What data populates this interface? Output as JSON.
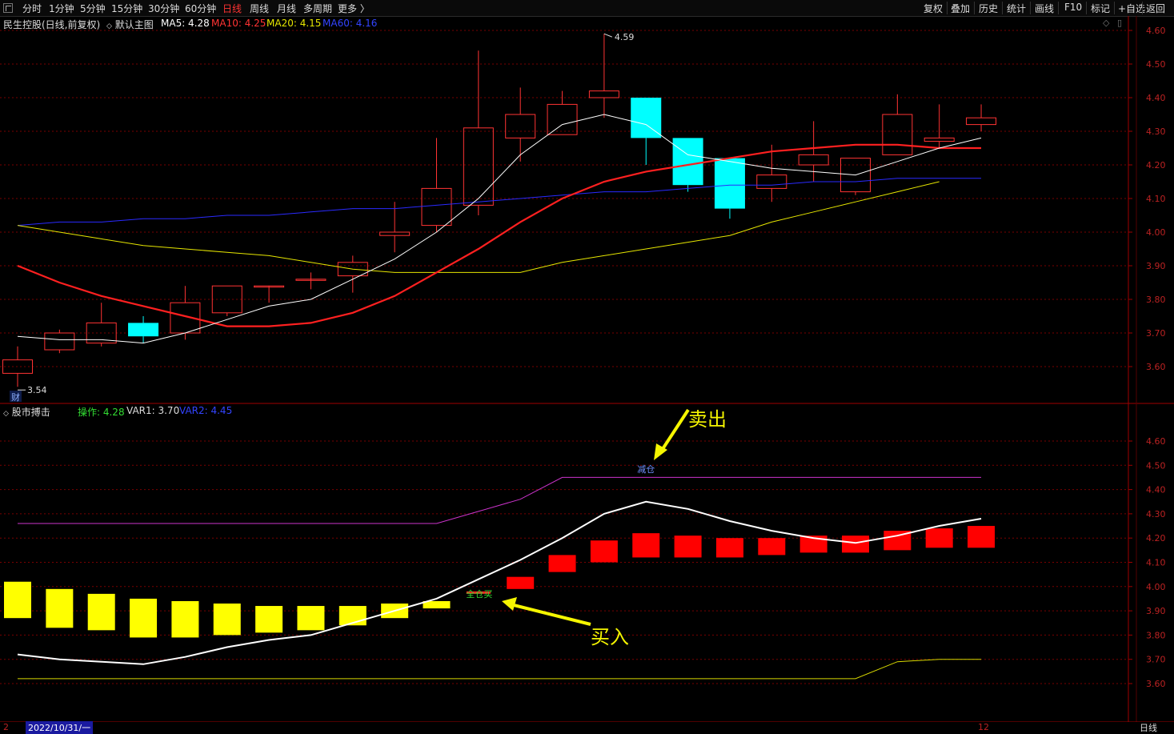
{
  "toolbar": {
    "periods": [
      "分时",
      "1分钟",
      "5分钟",
      "15分钟",
      "30分钟",
      "60分钟",
      "日线",
      "周线",
      "月线",
      "多周期",
      "更多 〉"
    ],
    "active_period": "日线",
    "right_buttons": [
      "复权",
      "叠加",
      "历史",
      "统计",
      "画线",
      "F10",
      "标记",
      "+自选",
      "返回"
    ]
  },
  "main_panel": {
    "stock_title": "民生控股(日线,前复权)",
    "indicator_name": "默认主图",
    "ma_legend": [
      {
        "label": "MA5: 4.28",
        "color": "#ffffff"
      },
      {
        "label": "MA10: 4.25",
        "color": "#ff3333"
      },
      {
        "label": "MA20: 4.15",
        "color": "#e6e600"
      },
      {
        "label": "MA60: 4.16",
        "color": "#3344ff"
      }
    ],
    "high_label": "4.59",
    "low_label": "3.54",
    "cai_label": "财"
  },
  "sub_panel": {
    "indicator_name": "股市搏击",
    "legend": [
      {
        "label": "操作: 4.28",
        "color": "#33dd33"
      },
      {
        "label": "VAR1: 3.70",
        "color": "#dcdcdc"
      },
      {
        "label": "VAR2: 4.45",
        "color": "#3344ff"
      }
    ],
    "sell_text": "减仓",
    "buy_text": "全仓买",
    "sell_annotation": "卖出",
    "buy_annotation": "买入"
  },
  "status": {
    "date": "2022/10/31/一",
    "left_mark": "2",
    "right_mark": "12",
    "period_label": "日线"
  },
  "colors": {
    "up": "#ff3333",
    "down": "#00ffff",
    "ma5": "#ffffff",
    "ma10": "#ff2020",
    "ma20": "#e6e600",
    "ma60": "#2a2aff",
    "grid": "#7a0000",
    "axis": "#a00000",
    "axis_text": "#bb2222",
    "var2": "#cc33cc",
    "var1": "#d8d800",
    "annotation": "#f5f500"
  },
  "chart_data": [
    {
      "type": "candlestick",
      "title": "民生控股(日线,前复权)",
      "y_ticks": [
        3.6,
        3.7,
        3.8,
        3.9,
        4.0,
        4.1,
        4.2,
        4.3,
        4.4,
        4.5,
        4.6
      ],
      "ylim": [
        3.5,
        4.62
      ],
      "candles": [
        {
          "o": 3.58,
          "h": 3.66,
          "l": 3.54,
          "c": 3.62
        },
        {
          "o": 3.65,
          "h": 3.71,
          "l": 3.64,
          "c": 3.7
        },
        {
          "o": 3.67,
          "h": 3.79,
          "l": 3.66,
          "c": 3.73
        },
        {
          "o": 3.73,
          "h": 3.75,
          "l": 3.67,
          "c": 3.69
        },
        {
          "o": 3.7,
          "h": 3.84,
          "l": 3.68,
          "c": 3.79
        },
        {
          "o": 3.76,
          "h": 3.84,
          "l": 3.75,
          "c": 3.84
        },
        {
          "o": 3.84,
          "h": 3.84,
          "l": 3.79,
          "c": 3.84
        },
        {
          "o": 3.86,
          "h": 3.88,
          "l": 3.83,
          "c": 3.86
        },
        {
          "o": 3.87,
          "h": 3.93,
          "l": 3.82,
          "c": 3.91
        },
        {
          "o": 3.99,
          "h": 4.09,
          "l": 3.94,
          "c": 4.0
        },
        {
          "o": 4.02,
          "h": 4.28,
          "l": 4.0,
          "c": 4.13
        },
        {
          "o": 4.08,
          "h": 4.54,
          "l": 4.05,
          "c": 4.31
        },
        {
          "o": 4.28,
          "h": 4.43,
          "l": 4.21,
          "c": 4.35
        },
        {
          "o": 4.29,
          "h": 4.42,
          "l": 4.29,
          "c": 4.38
        },
        {
          "o": 4.4,
          "h": 4.59,
          "l": 4.34,
          "c": 4.42
        },
        {
          "o": 4.4,
          "h": 4.4,
          "l": 4.2,
          "c": 4.28
        },
        {
          "o": 4.28,
          "h": 4.28,
          "l": 4.12,
          "c": 4.14
        },
        {
          "o": 4.22,
          "h": 4.22,
          "l": 4.04,
          "c": 4.07
        },
        {
          "o": 4.13,
          "h": 4.26,
          "l": 4.09,
          "c": 4.17
        },
        {
          "o": 4.2,
          "h": 4.33,
          "l": 4.15,
          "c": 4.23
        },
        {
          "o": 4.12,
          "h": 4.22,
          "l": 4.11,
          "c": 4.22
        },
        {
          "o": 4.23,
          "h": 4.41,
          "l": 4.23,
          "c": 4.35
        },
        {
          "o": 4.27,
          "h": 4.38,
          "l": 4.25,
          "c": 4.28
        },
        {
          "o": 4.32,
          "h": 4.38,
          "l": 4.3,
          "c": 4.34
        }
      ],
      "series": [
        {
          "name": "MA5",
          "color": "#ffffff",
          "values": [
            3.69,
            3.68,
            3.68,
            3.67,
            3.7,
            3.74,
            3.78,
            3.8,
            3.86,
            3.92,
            4.0,
            4.1,
            4.23,
            4.32,
            4.35,
            4.32,
            4.23,
            4.21,
            4.19,
            4.18,
            4.17,
            4.21,
            4.25,
            4.28
          ]
        },
        {
          "name": "MA10",
          "color": "#ff2020",
          "values": [
            3.9,
            3.85,
            3.81,
            3.78,
            3.75,
            3.72,
            3.72,
            3.73,
            3.76,
            3.81,
            3.88,
            3.95,
            4.03,
            4.1,
            4.15,
            4.18,
            4.2,
            4.22,
            4.24,
            4.25,
            4.26,
            4.26,
            4.25,
            4.25
          ]
        },
        {
          "name": "MA20",
          "color": "#e6e600",
          "values": [
            4.02,
            4.0,
            3.98,
            3.96,
            3.95,
            3.94,
            3.93,
            3.91,
            3.89,
            3.88,
            3.88,
            3.88,
            3.88,
            3.91,
            3.93,
            3.95,
            3.97,
            3.99,
            4.03,
            4.06,
            4.09,
            4.12,
            4.15
          ]
        },
        {
          "name": "MA60",
          "color": "#2a2aff",
          "values": [
            4.02,
            4.03,
            4.03,
            4.04,
            4.04,
            4.05,
            4.05,
            4.06,
            4.07,
            4.07,
            4.08,
            4.09,
            4.1,
            4.11,
            4.12,
            4.12,
            4.13,
            4.14,
            4.14,
            4.15,
            4.15,
            4.16,
            4.16,
            4.16
          ]
        }
      ]
    },
    {
      "type": "bar",
      "title": "股市搏击",
      "y_ticks": [
        3.6,
        3.7,
        3.8,
        3.9,
        4.0,
        4.1,
        4.2,
        4.3,
        4.4,
        4.5,
        4.6
      ],
      "ylim": [
        3.53,
        4.71
      ],
      "boxes": [
        {
          "lo": 3.87,
          "hi": 4.02,
          "color": "#ffff00"
        },
        {
          "lo": 3.83,
          "hi": 3.99,
          "color": "#ffff00"
        },
        {
          "lo": 3.82,
          "hi": 3.97,
          "color": "#ffff00"
        },
        {
          "lo": 3.79,
          "hi": 3.95,
          "color": "#ffff00"
        },
        {
          "lo": 3.79,
          "hi": 3.94,
          "color": "#ffff00"
        },
        {
          "lo": 3.8,
          "hi": 3.93,
          "color": "#ffff00"
        },
        {
          "lo": 3.81,
          "hi": 3.92,
          "color": "#ffff00"
        },
        {
          "lo": 3.82,
          "hi": 3.92,
          "color": "#ffff00"
        },
        {
          "lo": 3.84,
          "hi": 3.92,
          "color": "#ffff00"
        },
        {
          "lo": 3.87,
          "hi": 3.93,
          "color": "#ffff00"
        },
        {
          "lo": 3.91,
          "hi": 3.94,
          "color": "#ffff00"
        },
        {
          "lo": 3.97,
          "hi": 3.98,
          "color": "#ff2020"
        },
        {
          "lo": 3.99,
          "hi": 4.04,
          "color": "#ff0000"
        },
        {
          "lo": 4.06,
          "hi": 4.13,
          "color": "#ff0000"
        },
        {
          "lo": 4.1,
          "hi": 4.19,
          "color": "#ff0000"
        },
        {
          "lo": 4.12,
          "hi": 4.22,
          "color": "#ff0000"
        },
        {
          "lo": 4.12,
          "hi": 4.21,
          "color": "#ff0000"
        },
        {
          "lo": 4.12,
          "hi": 4.2,
          "color": "#ff0000"
        },
        {
          "lo": 4.13,
          "hi": 4.2,
          "color": "#ff0000"
        },
        {
          "lo": 4.14,
          "hi": 4.21,
          "color": "#ff0000"
        },
        {
          "lo": 4.14,
          "hi": 4.21,
          "color": "#ff0000"
        },
        {
          "lo": 4.15,
          "hi": 4.23,
          "color": "#ff0000"
        },
        {
          "lo": 4.16,
          "hi": 4.24,
          "color": "#ff0000"
        },
        {
          "lo": 4.16,
          "hi": 4.25,
          "color": "#ff0000"
        }
      ],
      "series": [
        {
          "name": "操作",
          "color": "#ffffff",
          "values": [
            3.72,
            3.7,
            3.69,
            3.68,
            3.71,
            3.75,
            3.78,
            3.8,
            3.85,
            3.9,
            3.95,
            4.03,
            4.11,
            4.2,
            4.3,
            4.35,
            4.32,
            4.27,
            4.23,
            4.2,
            4.18,
            4.21,
            4.25,
            4.28
          ]
        },
        {
          "name": "VAR1",
          "color": "#d8d800",
          "values": [
            3.62,
            3.62,
            3.62,
            3.62,
            3.62,
            3.62,
            3.62,
            3.62,
            3.62,
            3.62,
            3.62,
            3.62,
            3.62,
            3.62,
            3.62,
            3.62,
            3.62,
            3.62,
            3.62,
            3.62,
            3.62,
            3.69,
            3.7,
            3.7
          ]
        },
        {
          "name": "VAR2",
          "color": "#cc33cc",
          "values": [
            4.26,
            4.26,
            4.26,
            4.26,
            4.26,
            4.26,
            4.26,
            4.26,
            4.26,
            4.26,
            4.26,
            4.31,
            4.36,
            4.45,
            4.45,
            4.45,
            4.45,
            4.45,
            4.45,
            4.45,
            4.45,
            4.45,
            4.45,
            4.45
          ]
        }
      ],
      "sell_index": 15,
      "buy_index": 11
    }
  ]
}
